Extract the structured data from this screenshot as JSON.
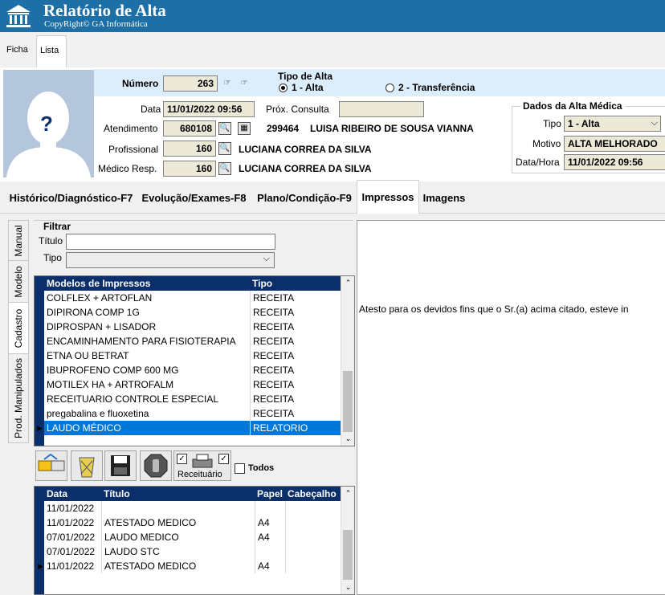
{
  "app": {
    "title": "Relatório de Alta",
    "subtitle": "CopyRight© GA Informática"
  },
  "top_tabs": [
    {
      "label": "Ficha",
      "active": false
    },
    {
      "label": "Lista",
      "active": true
    }
  ],
  "header": {
    "numero_label": "Número",
    "numero_value": "263",
    "tipo_alta_label": "Tipo de Alta",
    "tipo_alta_options": [
      {
        "label": "1 - Alta",
        "checked": true
      },
      {
        "label": "2 - Transferência",
        "checked": false
      }
    ],
    "data_label": "Data",
    "data_value": "11/01/2022 09:56",
    "prox_consulta_label": "Próx. Consulta",
    "prox_consulta_value": "",
    "atendimento_label": "Atendimento",
    "atendimento_value": "680108",
    "paciente_codigo": "299464",
    "paciente_nome": "LUISA RIBEIRO DE SOUSA VIANNA",
    "profissional_label": "Profissional",
    "profissional_codigo": "160",
    "profissional_nome": "LUCIANA CORREA DA SILVA",
    "medico_resp_label": "Médico Resp.",
    "medico_resp_codigo": "160",
    "medico_resp_nome": "LUCIANA CORREA DA SILVA",
    "photo_placeholder": "?"
  },
  "dados_alta": {
    "title": "Dados da Alta Médica",
    "tipo_label": "Tipo",
    "tipo_value": "1 - Alta",
    "motivo_label": "Motivo",
    "motivo_value": "ALTA MELHORADO",
    "datahora_label": "Data/Hora",
    "datahora_value": "11/01/2022 09:56"
  },
  "mid_tabs": [
    {
      "label": "Histórico/Diagnóstico-F7",
      "active": false
    },
    {
      "label": "Evolução/Exames-F8",
      "active": false
    },
    {
      "label": "Plano/Condição-F9",
      "active": false
    },
    {
      "label": "Impressos",
      "active": true
    },
    {
      "label": "Imagens",
      "active": false
    }
  ],
  "side_tabs": [
    {
      "label": "Manual",
      "active": false
    },
    {
      "label": "Modelo",
      "active": false
    },
    {
      "label": "Cadastro",
      "active": true
    },
    {
      "label": "Prod. Manipulados",
      "active": false
    }
  ],
  "filtrar": {
    "title": "Filtrar",
    "titulo_label": "Título",
    "titulo_value": "",
    "tipo_label": "Tipo",
    "tipo_value": ""
  },
  "modelos": {
    "columns": [
      "Modelos de Impressos",
      "Tipo"
    ],
    "rows": [
      {
        "nome": "COLFLEX + ARTOFLAN",
        "tipo": "RECEITA",
        "selected": false
      },
      {
        "nome": "DIPIRONA COMP 1G",
        "tipo": "RECEITA",
        "selected": false
      },
      {
        "nome": "DIPROSPAN + LISADOR",
        "tipo": "RECEITA",
        "selected": false
      },
      {
        "nome": "ENCAMINHAMENTO PARA FISIOTERAPIA",
        "tipo": "RECEITA",
        "selected": false
      },
      {
        "nome": "ETNA OU BETRAT",
        "tipo": "RECEITA",
        "selected": false
      },
      {
        "nome": "IBUPROFENO COMP 600 MG",
        "tipo": "RECEITA",
        "selected": false
      },
      {
        "nome": "MOTILEX HA + ARTROFALM",
        "tipo": "RECEITA",
        "selected": false
      },
      {
        "nome": "RECEITUARIO CONTROLE ESPECIAL",
        "tipo": "RECEITA",
        "selected": false
      },
      {
        "nome": "pregabalina e fluoxetina",
        "tipo": "RECEITA",
        "selected": false
      },
      {
        "nome": "LAUDO MÉDICO",
        "tipo": "RELATORIO",
        "selected": true
      }
    ]
  },
  "toolbar": {
    "receituario_label": "Receituário",
    "todos_label": "Todos",
    "receituario_checked": true,
    "todos_checked": false
  },
  "impressos": {
    "columns": [
      "Data",
      "Título",
      "Papel",
      "Cabeçalho"
    ],
    "rows": [
      {
        "data": "11/01/2022",
        "titulo": "",
        "papel": "",
        "cabecalho": "",
        "current": false
      },
      {
        "data": "11/01/2022",
        "titulo": "ATESTADO MEDICO",
        "papel": "A4",
        "cabecalho": "",
        "current": false
      },
      {
        "data": "07/01/2022",
        "titulo": "LAUDO MEDICO",
        "papel": "A4",
        "cabecalho": "",
        "current": false
      },
      {
        "data": "07/01/2022",
        "titulo": "LAUDO STC",
        "papel": "",
        "cabecalho": "",
        "current": false
      },
      {
        "data": "11/01/2022",
        "titulo": "ATESTADO MEDICO",
        "papel": "A4",
        "cabecalho": "",
        "current": true
      }
    ]
  },
  "preview": {
    "text": "Atesto para os devidos fins que o Sr.(a) acima citado, esteve in"
  },
  "colors": {
    "titlebar": "#1d6fa5",
    "grid_header": "#0a2f6b",
    "selection": "#0078d7",
    "readonly_field": "#ece9d8",
    "info_band": "#dceefb"
  }
}
